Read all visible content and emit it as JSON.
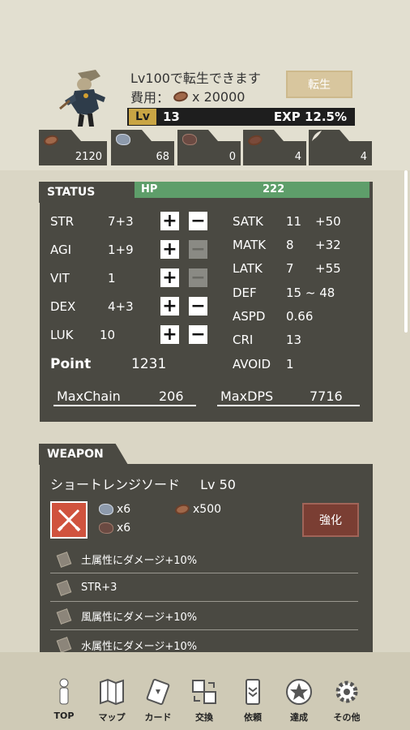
{
  "header": {
    "rebirth_text": "Lv100で転生できます",
    "cost_label": "費用：",
    "cost_value": "x 20000",
    "rebirth_button": "転生",
    "level_badge": "Lv",
    "level_value": "13",
    "exp_label": "EXP 12.5%"
  },
  "resources": [
    {
      "icon": "bean-icon",
      "value": "2120"
    },
    {
      "icon": "ore-icon",
      "value": "68"
    },
    {
      "icon": "dark-ore-icon",
      "value": "0"
    },
    {
      "icon": "bean-icon",
      "value": "4"
    },
    {
      "icon": "feather-icon",
      "value": "4"
    }
  ],
  "status": {
    "tab": "STATUS",
    "hp_label": "HP",
    "hp_value": "222",
    "stats": [
      {
        "name": "STR",
        "value": "7+3"
      },
      {
        "name": "AGI",
        "value": "1+9"
      },
      {
        "name": "VIT",
        "value": "1"
      },
      {
        "name": "DEX",
        "value": "4+3"
      },
      {
        "name": "LUK",
        "value": "10"
      }
    ],
    "point_label": "Point",
    "point_value": "1231",
    "derived": [
      {
        "name": "SATK",
        "value": "11",
        "bonus": "+50"
      },
      {
        "name": "MATK",
        "value": "8",
        "bonus": "+32"
      },
      {
        "name": "LATK",
        "value": "7",
        "bonus": "+55"
      },
      {
        "name": "DEF",
        "value": "15 ~ 48",
        "bonus": ""
      },
      {
        "name": "ASPD",
        "value": "0.66",
        "bonus": ""
      },
      {
        "name": "CRI",
        "value": "13",
        "bonus": ""
      },
      {
        "name": "AVOID",
        "value": "1",
        "bonus": ""
      }
    ],
    "maxchain_label": "MaxChain",
    "maxchain_value": "206",
    "maxdps_label": "MaxDPS",
    "maxdps_value": "7716"
  },
  "weapon": {
    "tab": "WEAPON",
    "name": "ショートレンジソード",
    "level": "Lv 50",
    "materials": [
      "x6",
      "x6",
      "x500"
    ],
    "enhance_button": "強化",
    "abilities": [
      "土属性にダメージ+10%",
      "STR+3",
      "風属性にダメージ+10%",
      "水属性にダメージ+10%"
    ]
  },
  "nav": [
    {
      "label": "TOP",
      "icon": "person-icon"
    },
    {
      "label": "マップ",
      "icon": "map-icon"
    },
    {
      "label": "カード",
      "icon": "card-icon"
    },
    {
      "label": "交換",
      "icon": "exchange-icon"
    },
    {
      "label": "依頼",
      "icon": "rank-icon"
    },
    {
      "label": "達成",
      "icon": "star-medal-icon"
    },
    {
      "label": "その他",
      "icon": "gear-icon"
    }
  ]
}
